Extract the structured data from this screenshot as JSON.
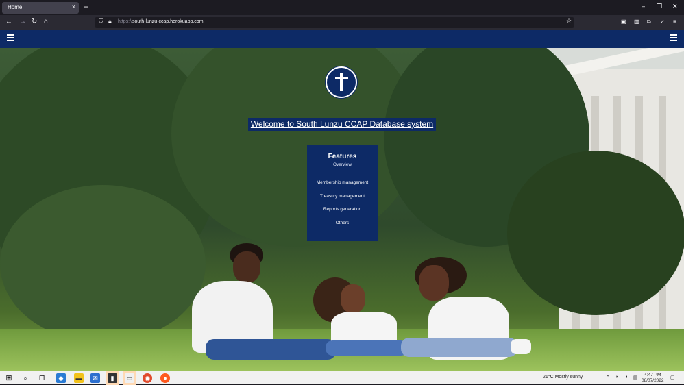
{
  "browser": {
    "tab_title": "Home",
    "tab_close": "×",
    "new_tab": "+",
    "url_protocol": "https://",
    "url_host": "south-lunzu-ccap.herokuapp.com",
    "minimize": "–",
    "maximize": "❐",
    "close": "✕"
  },
  "site": {
    "welcome_text": "Welcome to South Lunzu CCAP Database system",
    "features": {
      "title": "Features",
      "subtitle": "Overview",
      "items": [
        "Membership management",
        "Treasury management",
        "Reports generation",
        "Others"
      ]
    }
  },
  "taskbar": {
    "weather": "21°C  Mostly sunny",
    "time": "4:47 PM",
    "date": "08/07/2022"
  },
  "colors": {
    "brand": "#0d2a66",
    "browser_bg": "#1c1b22",
    "toolbar_bg": "#2b2a33"
  }
}
